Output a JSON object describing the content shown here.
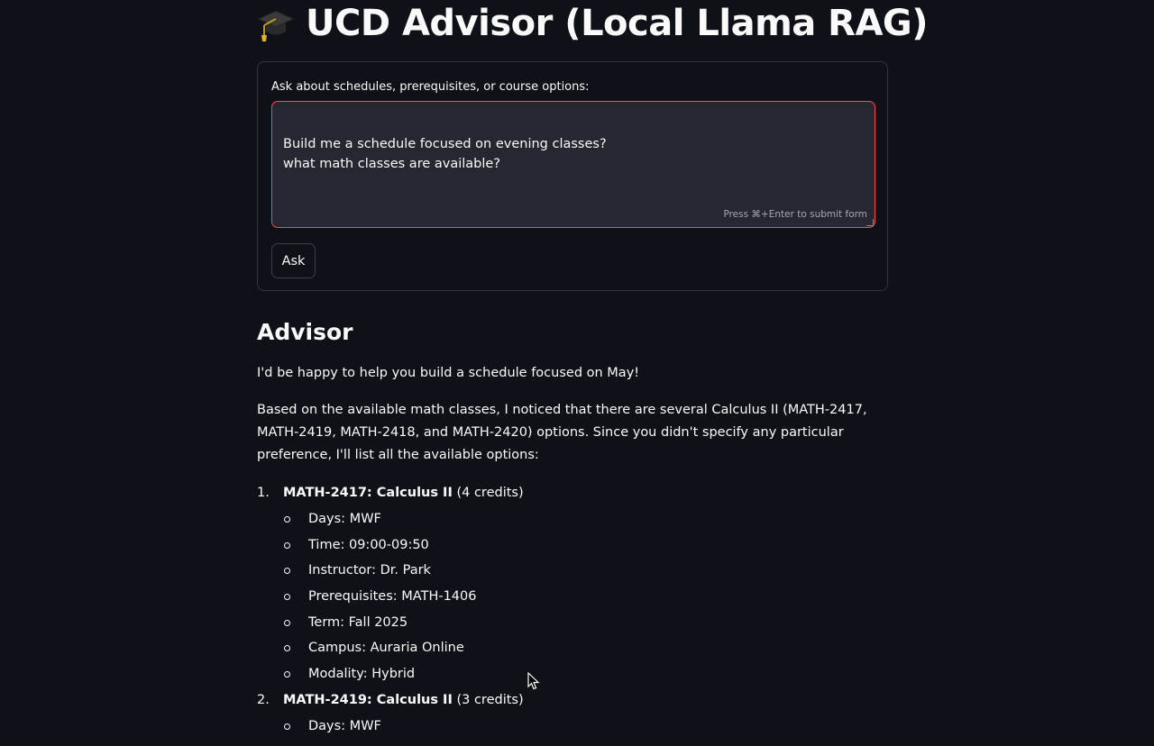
{
  "header": {
    "title": "UCD Advisor (Local Llama RAG)",
    "icon": "graduation-cap-icon"
  },
  "form": {
    "label": "Ask about schedules, prerequisites, or course options:",
    "query_value": "Build me a schedule focused on evening classes?\nwhat math classes are available?",
    "submit_hint": "Press ⌘+Enter to submit form",
    "ask_label": "Ask"
  },
  "answer": {
    "heading": "Advisor",
    "intro": "I'd be happy to help you build a schedule focused on May!",
    "summary": "Based on the available math classes, I noticed that there are several Calculus II (MATH-2417, MATH-2419, MATH-2418, and MATH-2420) options. Since you didn't specify any particular preference, I'll list all the available options:",
    "courses": [
      {
        "number": "1.",
        "title": "MATH-2417: Calculus II",
        "credits": " (4 credits)",
        "details": [
          "Days: MWF",
          "Time: 09:00-09:50",
          "Instructor: Dr. Park",
          "Prerequisites: MATH-1406",
          "Term: Fall 2025",
          "Campus: Auraria Online",
          "Modality: Hybrid"
        ]
      },
      {
        "number": "2.",
        "title": "MATH-2419: Calculus II",
        "credits": " (3 credits)",
        "details": [
          "Days: MWF"
        ]
      }
    ]
  },
  "colors": {
    "background": "#0e1117",
    "input_background": "#262730",
    "focus_border": "#ff4b4b",
    "text": "#fafafa"
  }
}
